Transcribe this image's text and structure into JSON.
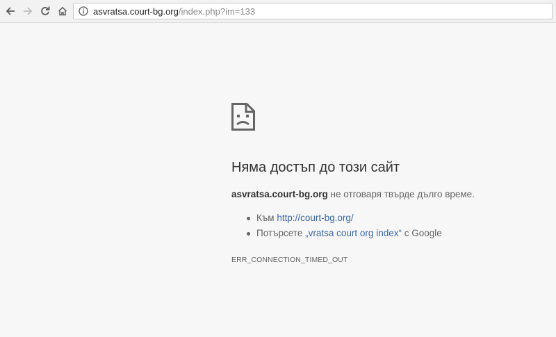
{
  "toolbar": {
    "back_icon": "arrow-left-icon",
    "forward_icon": "arrow-right-icon",
    "reload_icon": "reload-icon",
    "home_icon": "home-icon",
    "info_icon": "info-circle-icon",
    "url_host": "asvratsa.court-bg.org",
    "url_path": "/index.php?im=133"
  },
  "error_page": {
    "icon": "sad-document-icon",
    "heading": "Няма достъп до този сайт",
    "summary_host": "asvratsa.court-bg.org",
    "summary_text": " не отговаря твърде дълго време.",
    "suggestions": [
      {
        "prefix": "Към ",
        "link": "http://court-bg.org/",
        "suffix": ""
      },
      {
        "prefix": "Потърсете ",
        "link": "„vratsa court org index“",
        "suffix": " с Google"
      }
    ],
    "error_code": "ERR_CONNECTION_TIMED_OUT"
  },
  "colors": {
    "background": "#f7f7f7",
    "text": "#646464",
    "heading": "#333333",
    "link": "#3c67a8"
  }
}
